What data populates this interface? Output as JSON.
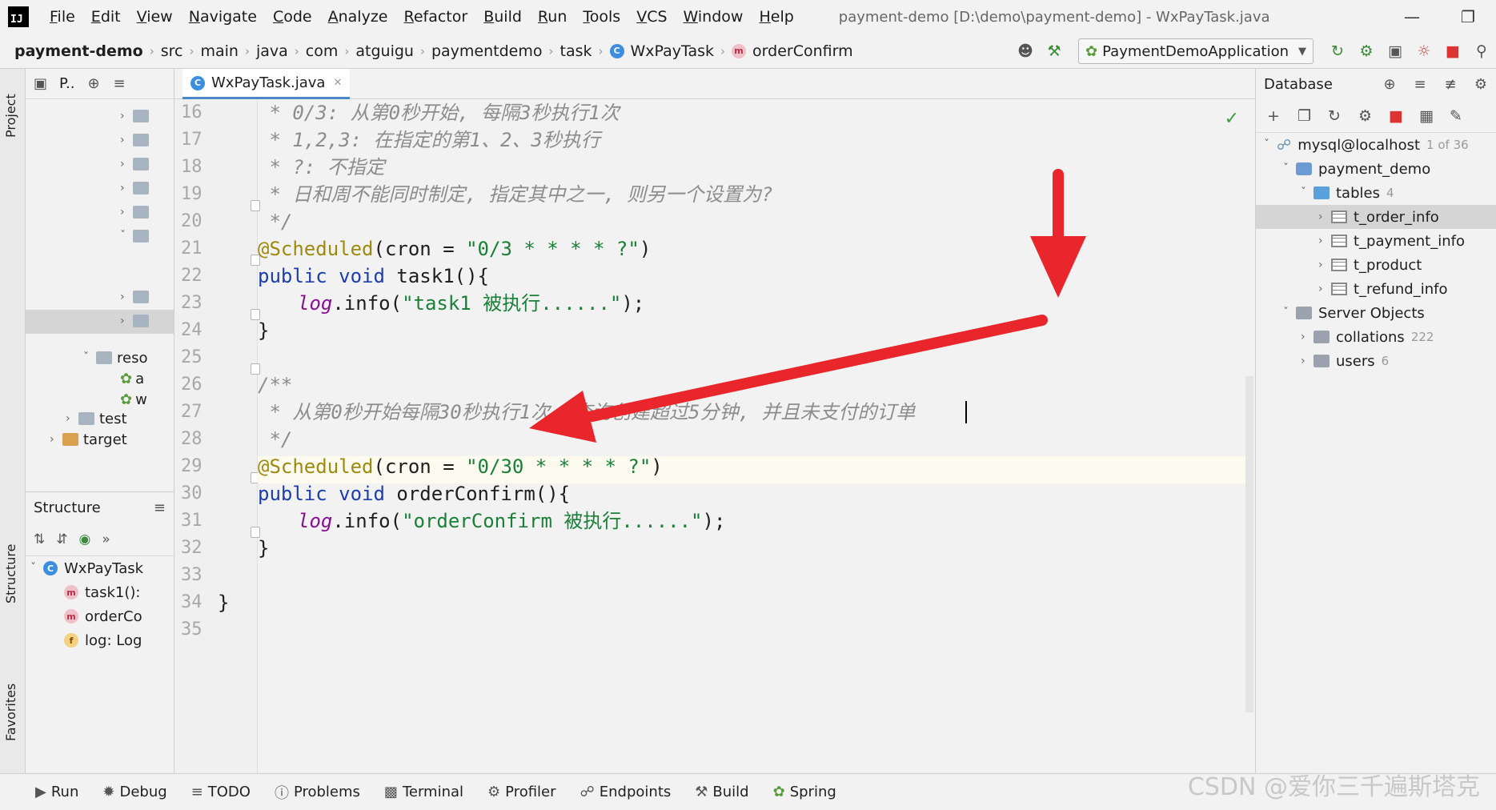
{
  "menubar": {
    "logo": "IJ",
    "items": [
      "File",
      "Edit",
      "View",
      "Navigate",
      "Code",
      "Analyze",
      "Refactor",
      "Build",
      "Run",
      "Tools",
      "VCS",
      "Window",
      "Help"
    ],
    "window_title": "payment-demo [D:\\demo\\payment-demo] - WxPayTask.java"
  },
  "navbar": {
    "breadcrumb": [
      "payment-demo",
      "src",
      "main",
      "java",
      "com",
      "atguigu",
      "paymentdemo",
      "task",
      "WxPayTask",
      "orderConfirm"
    ],
    "run_config": "PaymentDemoApplication"
  },
  "left_stripe": {
    "project": "Project",
    "structure": "Structure",
    "favorites": "Favorites"
  },
  "project_panel": {
    "title": "P..",
    "tree": {
      "reso": "reso",
      "test": "test",
      "target": "target",
      "item_a": "a",
      "item_w": "w"
    }
  },
  "structure_panel": {
    "title": "Structure",
    "items": {
      "class": "WxPayTask",
      "task1": "task1():",
      "order": "orderCo",
      "log": "log: Log"
    }
  },
  "editor": {
    "tab": "WxPayTask.java",
    "line_numbers": [
      "16",
      "17",
      "18",
      "19",
      "20",
      "21",
      "22",
      "23",
      "24",
      "25",
      "26",
      "27",
      "28",
      "29",
      "30",
      "31",
      "32",
      "33",
      "34",
      "35"
    ],
    "lines": {
      "l16": " * 0/3: 从第0秒开始, 每隔3秒执行1次",
      "l17": " * 1,2,3: 在指定的第1、2、3秒执行",
      "l18": " * ?: 不指定",
      "l19": " * 日和周不能同时制定, 指定其中之一, 则另一个设置为?",
      "l20": " */",
      "l21_ann": "@Scheduled",
      "l21_open": "(cron = ",
      "l21_str": "\"0/3 * * * * ?\"",
      "l21_close": ")",
      "l22_kw": "public void ",
      "l22_rest": "task1(){",
      "l23_field": "log",
      "l23_mid": ".info(",
      "l23_str": "\"task1 被执行......\"",
      "l23_end": ");",
      "l24": "}",
      "l26": "/**",
      "l27": " * 从第0秒开始每隔30秒执行1次, 查询创建超过5分钟, 并且未支付的订单",
      "l28": " */",
      "l29_ann": "@Scheduled",
      "l29_open": "(cron = ",
      "l29_str": "\"0/30 * * * * ?\"",
      "l29_close": ")",
      "l30_kw": "public void ",
      "l30_rest": "orderConfirm(){",
      "l31_field": "log",
      "l31_mid": ".info(",
      "l31_str": "\"orderConfirm 被执行......\"",
      "l31_end": ");",
      "l32": "}",
      "l34": "}"
    }
  },
  "database_panel": {
    "title": "Database",
    "connection": "mysql@localhost",
    "connection_count": "1 of 36",
    "schema": "payment_demo",
    "tables_label": "tables",
    "tables_count": "4",
    "tables": [
      "t_order_info",
      "t_payment_info",
      "t_product",
      "t_refund_info"
    ],
    "server_objects": "Server Objects",
    "collations": "collations",
    "collations_count": "222",
    "users": "users",
    "users_count": "6"
  },
  "bottombar": {
    "tabs": [
      "Run",
      "Debug",
      "TODO",
      "Problems",
      "Terminal",
      "Profiler",
      "Endpoints",
      "Build",
      "Spring"
    ],
    "watermark": "CSDN @爱你三千遍斯塔克"
  },
  "colors": {
    "keyword": "#1c3dae",
    "annotation": "#9e8a0e",
    "string": "#1a7f37",
    "comment": "#8c8c8c",
    "arrow": "#e8262c"
  }
}
